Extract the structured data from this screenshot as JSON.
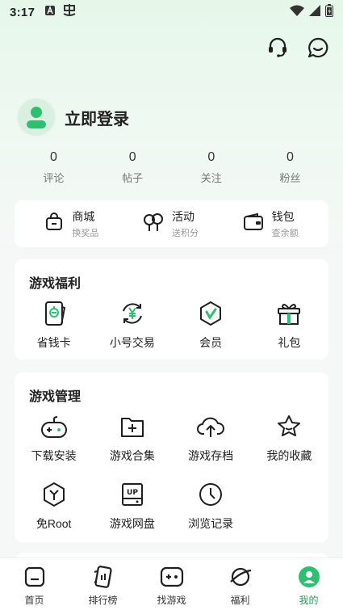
{
  "status_bar": {
    "time": "3:17"
  },
  "colors": {
    "accent": "#2fbf71",
    "icon": "#1f1f1f",
    "avatar_bg": "#d9efe0"
  },
  "profile": {
    "login_text": "立即登录"
  },
  "stats": [
    {
      "value": "0",
      "label": "评论"
    },
    {
      "value": "0",
      "label": "帖子"
    },
    {
      "value": "0",
      "label": "关注"
    },
    {
      "value": "0",
      "label": "粉丝"
    }
  ],
  "quick": [
    {
      "title": "商城",
      "sub": "换奖品",
      "icon": "bag-icon"
    },
    {
      "title": "活动",
      "sub": "送积分",
      "icon": "balloon-icon"
    },
    {
      "title": "钱包",
      "sub": "查余额",
      "icon": "wallet-icon"
    }
  ],
  "welfare": {
    "title": "游戏福利",
    "items": [
      {
        "label": "省钱卡",
        "icon": "card-icon"
      },
      {
        "label": "小号交易",
        "icon": "yen-exchange-icon"
      },
      {
        "label": "会员",
        "icon": "vip-icon"
      },
      {
        "label": "礼包",
        "icon": "gift-icon"
      }
    ]
  },
  "manage": {
    "title": "游戏管理",
    "items": [
      {
        "label": "下载安装",
        "icon": "gamepad-icon"
      },
      {
        "label": "游戏合集",
        "icon": "folder-plus-icon"
      },
      {
        "label": "游戏存档",
        "icon": "cloud-upload-icon"
      },
      {
        "label": "我的收藏",
        "icon": "star-icon"
      },
      {
        "label": "免Root",
        "icon": "hexagon-y-icon"
      },
      {
        "label": "游戏网盘",
        "icon": "up-disk-icon"
      },
      {
        "label": "浏览记录",
        "icon": "clock-icon"
      }
    ]
  },
  "nav": [
    {
      "label": "首页",
      "icon": "home-icon"
    },
    {
      "label": "排行榜",
      "icon": "rank-icon"
    },
    {
      "label": "找游戏",
      "icon": "find-game-icon"
    },
    {
      "label": "福利",
      "icon": "planet-icon"
    },
    {
      "label": "我的",
      "icon": "mine-icon"
    }
  ]
}
